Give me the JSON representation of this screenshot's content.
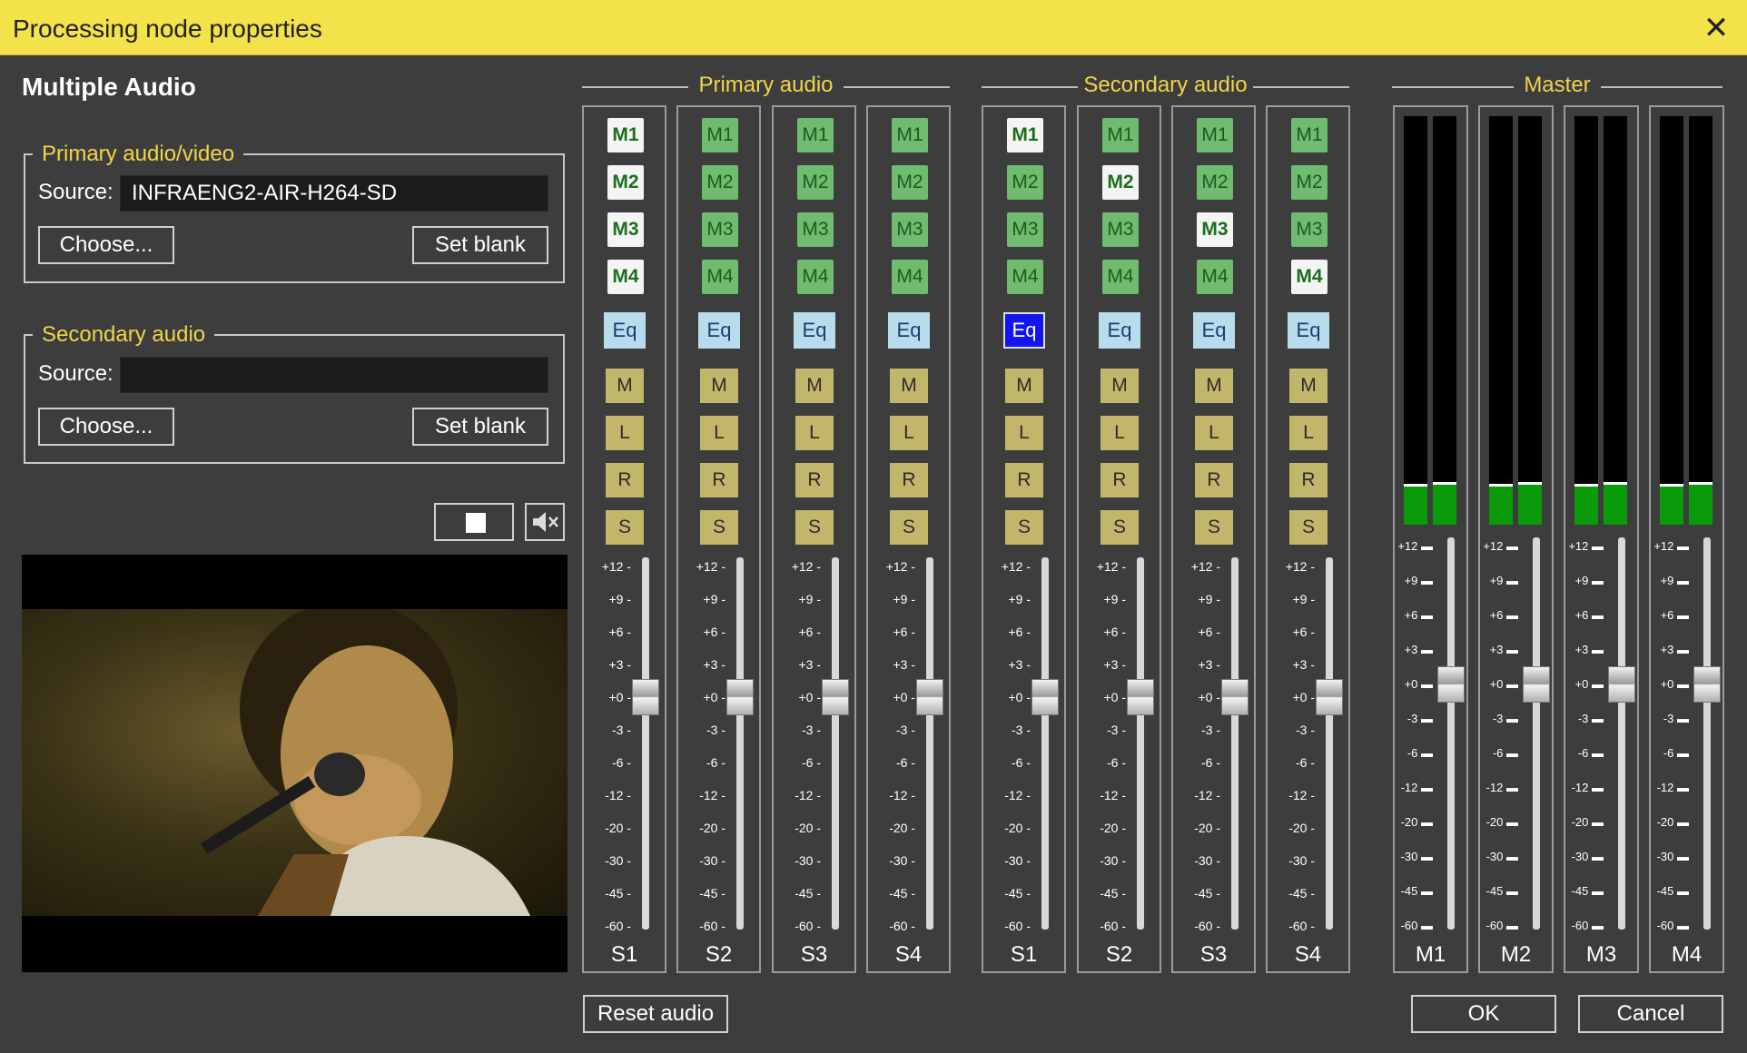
{
  "window": {
    "title": "Processing node properties",
    "close_glyph": "✕"
  },
  "heading": "Multiple Audio",
  "primary_av": {
    "legend": "Primary audio/video",
    "source_label": "Source:",
    "source_value": "INFRAENG2-AIR-H264-SD",
    "choose_label": "Choose...",
    "set_blank_label": "Set blank"
  },
  "secondary": {
    "legend": "Secondary audio",
    "source_label": "Source:",
    "source_value": "",
    "choose_label": "Choose...",
    "set_blank_label": "Set blank"
  },
  "preview_controls": {
    "stop_icon": "stop-icon",
    "mute_icon": "speaker-mute-icon"
  },
  "sections": {
    "primary": "Primary audio",
    "secondary": "Secondary audio",
    "master": "Master"
  },
  "routing_labels": [
    "M1",
    "M2",
    "M3",
    "M4"
  ],
  "eq_label": "Eq",
  "toggle_labels": [
    "M",
    "L",
    "R",
    "S"
  ],
  "fader_scale": [
    "+12",
    "+9",
    "+6",
    "+3",
    "+0",
    "-3",
    "-6",
    "-12",
    "-20",
    "-30",
    "-45",
    "-60"
  ],
  "primary_strips": [
    {
      "label": "S1",
      "routes_on": [
        1,
        1,
        1,
        1
      ],
      "eq_on": false,
      "gain_db": 0
    },
    {
      "label": "S2",
      "routes_on": [
        0,
        0,
        0,
        0
      ],
      "eq_on": false,
      "gain_db": 0
    },
    {
      "label": "S3",
      "routes_on": [
        0,
        0,
        0,
        0
      ],
      "eq_on": false,
      "gain_db": 0
    },
    {
      "label": "S4",
      "routes_on": [
        0,
        0,
        0,
        0
      ],
      "eq_on": false,
      "gain_db": 0
    }
  ],
  "secondary_strips": [
    {
      "label": "S1",
      "routes_on": [
        1,
        0,
        0,
        0
      ],
      "eq_on": true,
      "gain_db": 0
    },
    {
      "label": "S2",
      "routes_on": [
        0,
        1,
        0,
        0
      ],
      "eq_on": false,
      "gain_db": 0
    },
    {
      "label": "S3",
      "routes_on": [
        0,
        0,
        1,
        0
      ],
      "eq_on": false,
      "gain_db": 0
    },
    {
      "label": "S4",
      "routes_on": [
        0,
        0,
        0,
        1
      ],
      "eq_on": false,
      "gain_db": 0
    }
  ],
  "master_strips": [
    {
      "label": "M1",
      "level_left": 0.1,
      "level_right": 0.105,
      "gain_db": 0
    },
    {
      "label": "M2",
      "level_left": 0.1,
      "level_right": 0.105,
      "gain_db": 0
    },
    {
      "label": "M3",
      "level_left": 0.1,
      "level_right": 0.105,
      "gain_db": 0
    },
    {
      "label": "M4",
      "level_left": 0.1,
      "level_right": 0.105,
      "gain_db": 0
    }
  ],
  "buttons": {
    "reset_audio": "Reset audio",
    "ok": "OK",
    "cancel": "Cancel"
  },
  "colors": {
    "title_bar": "#f3e24a",
    "accent_text": "#f0d54a",
    "route_button": "#6fbb6f",
    "eq_button": "#b7dcec",
    "eq_active": "#1414f0",
    "toggle_button": "#c2b66a",
    "meter_level": "#0a9a0a"
  }
}
